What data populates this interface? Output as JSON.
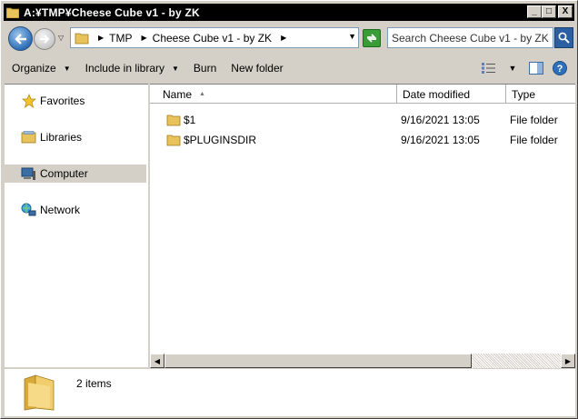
{
  "window": {
    "title": "A:¥TMP¥Cheese Cube v1 - by ZK",
    "controls": {
      "minimize": "_",
      "maximize": "□",
      "close": "X"
    }
  },
  "address": {
    "breadcrumbs": [
      "TMP",
      "Cheese Cube v1 - by ZK"
    ],
    "search_placeholder": "Search Cheese Cube v1 - by ZK"
  },
  "toolbar": {
    "organize": "Organize",
    "include_in_library": "Include in library",
    "burn": "Burn",
    "new_folder": "New folder"
  },
  "nav": {
    "items": [
      {
        "label": "Favorites",
        "icon": "star-icon"
      },
      {
        "label": "Libraries",
        "icon": "libraries-icon"
      },
      {
        "label": "Computer",
        "icon": "computer-icon",
        "selected": true
      },
      {
        "label": "Network",
        "icon": "network-icon"
      }
    ]
  },
  "files": {
    "columns": [
      "Name",
      "Date modified",
      "Type"
    ],
    "rows": [
      {
        "name": "$1",
        "date": "9/16/2021 13:05",
        "type": "File folder"
      },
      {
        "name": "$PLUGINSDIR",
        "date": "9/16/2021 13:05",
        "type": "File folder"
      }
    ]
  },
  "status": {
    "count": "2 items"
  },
  "colors": {
    "titlebar": "#000000",
    "chrome": "#d4d0c8",
    "accent": "#2d6fb8",
    "folder": "#e8c25a"
  }
}
